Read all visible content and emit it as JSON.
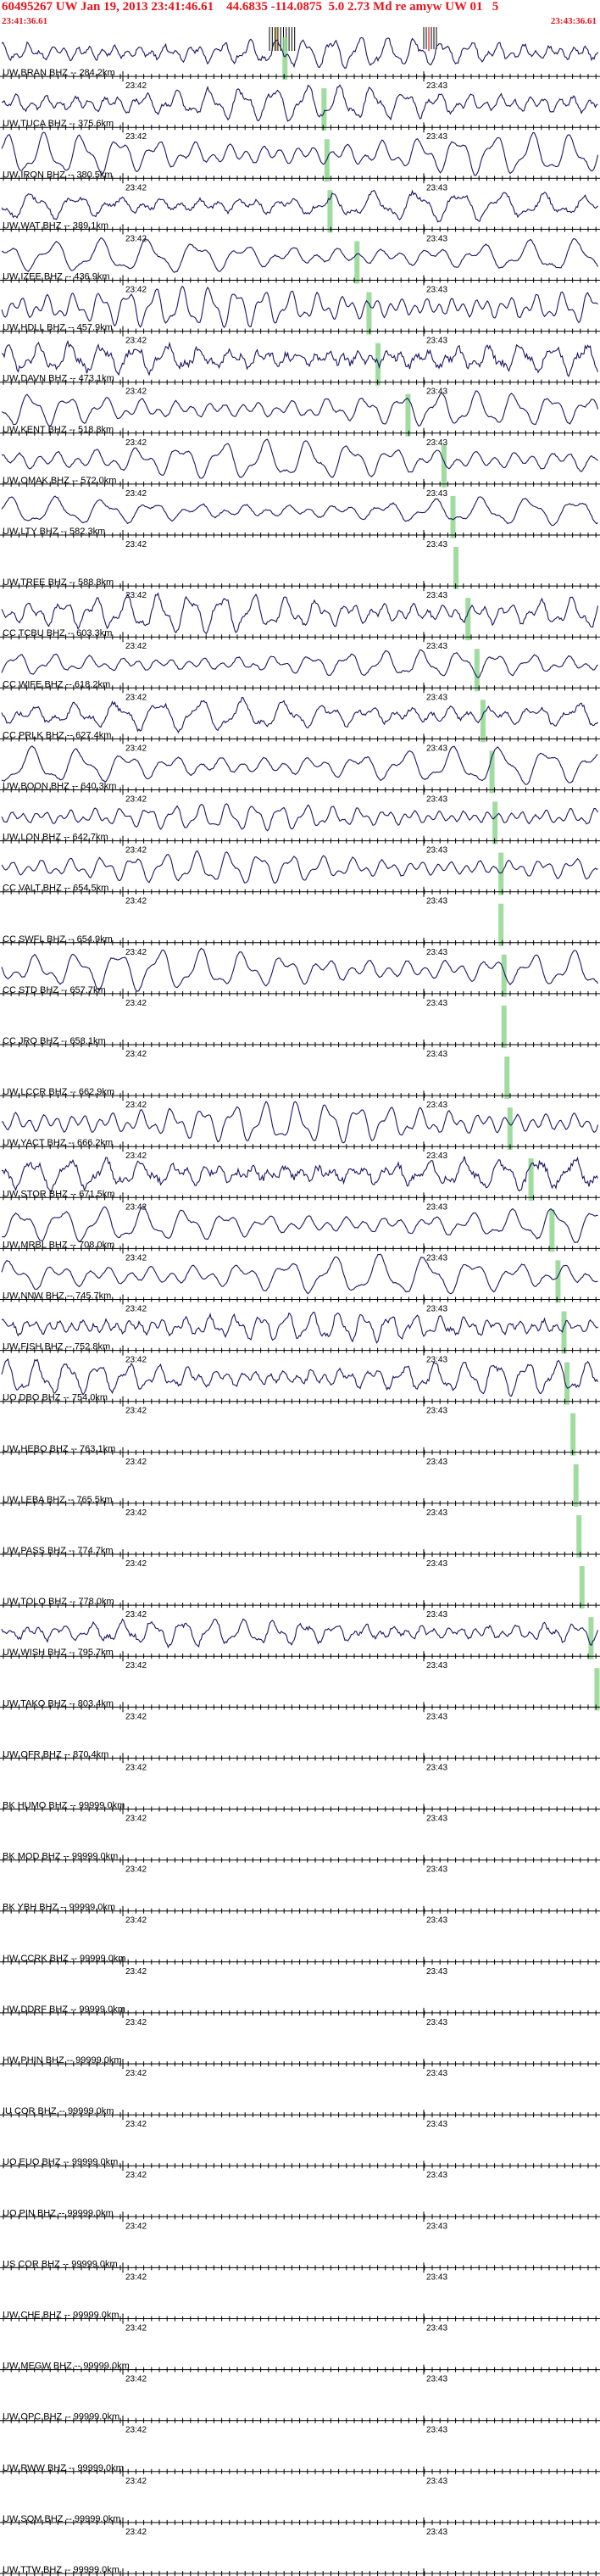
{
  "header": {
    "title": "60495267 UW Jan 19, 2013 23:41:46.61    44.6835 -114.0875  5.0 2.73 Md re amyw UW 01   5",
    "start_time": "23:41:36.61",
    "end_time": "23:43:36.61"
  },
  "colors": {
    "header_text": "#e8141b",
    "trace": "#1c1464",
    "axis": "#000000",
    "arrival_marker": "#8fd68f",
    "pick_marker": "#e8141b"
  },
  "chart_data": {
    "type": "line",
    "time_labels": [
      "23:42",
      "23:43"
    ],
    "stations": [
      {
        "label": "UW BRAN BHZ -- 284.2km",
        "has_trace": true,
        "arrival": 0.475
      },
      {
        "label": "UW TUCA BHZ -- 375.6km",
        "has_trace": true,
        "arrival": 0.54
      },
      {
        "label": "UW IRON BHZ -- 380.5km",
        "has_trace": true,
        "arrival": 0.545
      },
      {
        "label": "UW WAT BHZ -- 389.1km",
        "has_trace": true,
        "arrival": 0.55
      },
      {
        "label": "UW IZEE BHZ -- 436.9km",
        "has_trace": true,
        "arrival": 0.595
      },
      {
        "label": "UW HDLL BHZ -- 457.9km",
        "has_trace": true,
        "arrival": 0.615
      },
      {
        "label": "UW DAVN BHZ -- 473.1km",
        "has_trace": true,
        "arrival": 0.63
      },
      {
        "label": "UW KENT BHZ -- 518.8km",
        "has_trace": true,
        "arrival": 0.68
      },
      {
        "label": "UW OMAK BHZ -- 572.0km",
        "has_trace": true,
        "arrival": 0.74
      },
      {
        "label": "UW LTY BHZ -- 582.3km",
        "has_trace": true,
        "arrival": 0.755
      },
      {
        "label": "UW TREE BHZ -- 588.8km",
        "has_trace": false,
        "arrival": 0.76
      },
      {
        "label": "CC TCBU BHZ -- 603.3km",
        "has_trace": true,
        "arrival": 0.78
      },
      {
        "label": "CC WIFE BHZ -- 618.2km",
        "has_trace": true,
        "arrival": 0.795
      },
      {
        "label": "CC PRLK BHZ -- 627.4km",
        "has_trace": true,
        "arrival": 0.805
      },
      {
        "label": "UW BOON BHZ -- 640.3km",
        "has_trace": true,
        "arrival": 0.82
      },
      {
        "label": "UW LON BHZ -- 642.7km",
        "has_trace": true,
        "arrival": 0.825
      },
      {
        "label": "CC VALT BHZ -- 654.5km",
        "has_trace": true,
        "arrival": 0.835
      },
      {
        "label": "CC SWFL BHZ -- 654.9km",
        "has_trace": false,
        "arrival": 0.835
      },
      {
        "label": "CC STD BHZ -- 657.7km",
        "has_trace": true,
        "arrival": 0.84
      },
      {
        "label": "CC JRO BHZ -- 658.1km",
        "has_trace": false,
        "arrival": 0.84
      },
      {
        "label": "UW LCCR BHZ -- 662.9km",
        "has_trace": false,
        "arrival": 0.845
      },
      {
        "label": "UW YACT BHZ -- 666.2km",
        "has_trace": true,
        "arrival": 0.85
      },
      {
        "label": "UW STOR BHZ -- 671.5km",
        "has_trace": true,
        "arrival": 0.885
      },
      {
        "label": "UW MRBL BHZ -- 708.0km",
        "has_trace": true,
        "arrival": 0.92
      },
      {
        "label": "UW NNW BHZ -- 745.7km",
        "has_trace": true,
        "arrival": 0.93
      },
      {
        "label": "UW FISH BHZ -- 752.8km",
        "has_trace": true,
        "arrival": 0.94
      },
      {
        "label": "UO DBO BHZ -- 754.0km",
        "has_trace": true,
        "arrival": 0.945
      },
      {
        "label": "UW HEBO BHZ -- 763.1km",
        "has_trace": false,
        "arrival": 0.955
      },
      {
        "label": "UW LEBA BHZ -- 765.5km",
        "has_trace": false,
        "arrival": 0.96
      },
      {
        "label": "UW PASS BHZ -- 774.7km",
        "has_trace": false,
        "arrival": 0.965
      },
      {
        "label": "UW TOLO BHZ -- 778.0km",
        "has_trace": false,
        "arrival": 0.97
      },
      {
        "label": "UW WISH BHZ -- 795.7km",
        "has_trace": true,
        "arrival": 0.985
      },
      {
        "label": "UW TAKO BHZ -- 803.4km",
        "has_trace": false,
        "arrival": 0.995
      },
      {
        "label": "UW OFR BHZ -- 870.4km",
        "has_trace": false,
        "arrival": null
      },
      {
        "label": "BK HUMO BHZ -- 99999.0km",
        "has_trace": false,
        "arrival": null
      },
      {
        "label": "BK MOD BHZ -- 99999.0km",
        "has_trace": false,
        "arrival": null
      },
      {
        "label": "BK YBH BHZ -- 99999.0km",
        "has_trace": false,
        "arrival": null
      },
      {
        "label": "HW CCRK BHZ -- 99999.0km",
        "has_trace": false,
        "arrival": null
      },
      {
        "label": "HW DDRF BHZ -- 99999.0km",
        "has_trace": false,
        "arrival": null
      },
      {
        "label": "HW PHIN BHZ -- 99999.0km",
        "has_trace": false,
        "arrival": null
      },
      {
        "label": "IU COR BHZ -- 99999.0km",
        "has_trace": false,
        "arrival": null
      },
      {
        "label": "UO EUO BHZ -- 99999.0km",
        "has_trace": false,
        "arrival": null
      },
      {
        "label": "UO PIN BHZ -- 99999.0km",
        "has_trace": false,
        "arrival": null
      },
      {
        "label": "US COR BHZ -- 99999.0km",
        "has_trace": false,
        "arrival": null
      },
      {
        "label": "UW CHE BHZ -- 99999.0km",
        "has_trace": false,
        "arrival": null
      },
      {
        "label": "UW MEGW BHZ -- 99999.0km",
        "has_trace": false,
        "arrival": null
      },
      {
        "label": "UW OPC BHZ -- 99999.0km",
        "has_trace": false,
        "arrival": null
      },
      {
        "label": "UW RWW BHZ -- 99999.0km",
        "has_trace": false,
        "arrival": null
      },
      {
        "label": "UW SQM BHZ -- 99999.0km",
        "has_trace": false,
        "arrival": null
      },
      {
        "label": "UW TTW BHZ -- 99999.0km",
        "has_trace": false,
        "arrival": null
      }
    ]
  }
}
